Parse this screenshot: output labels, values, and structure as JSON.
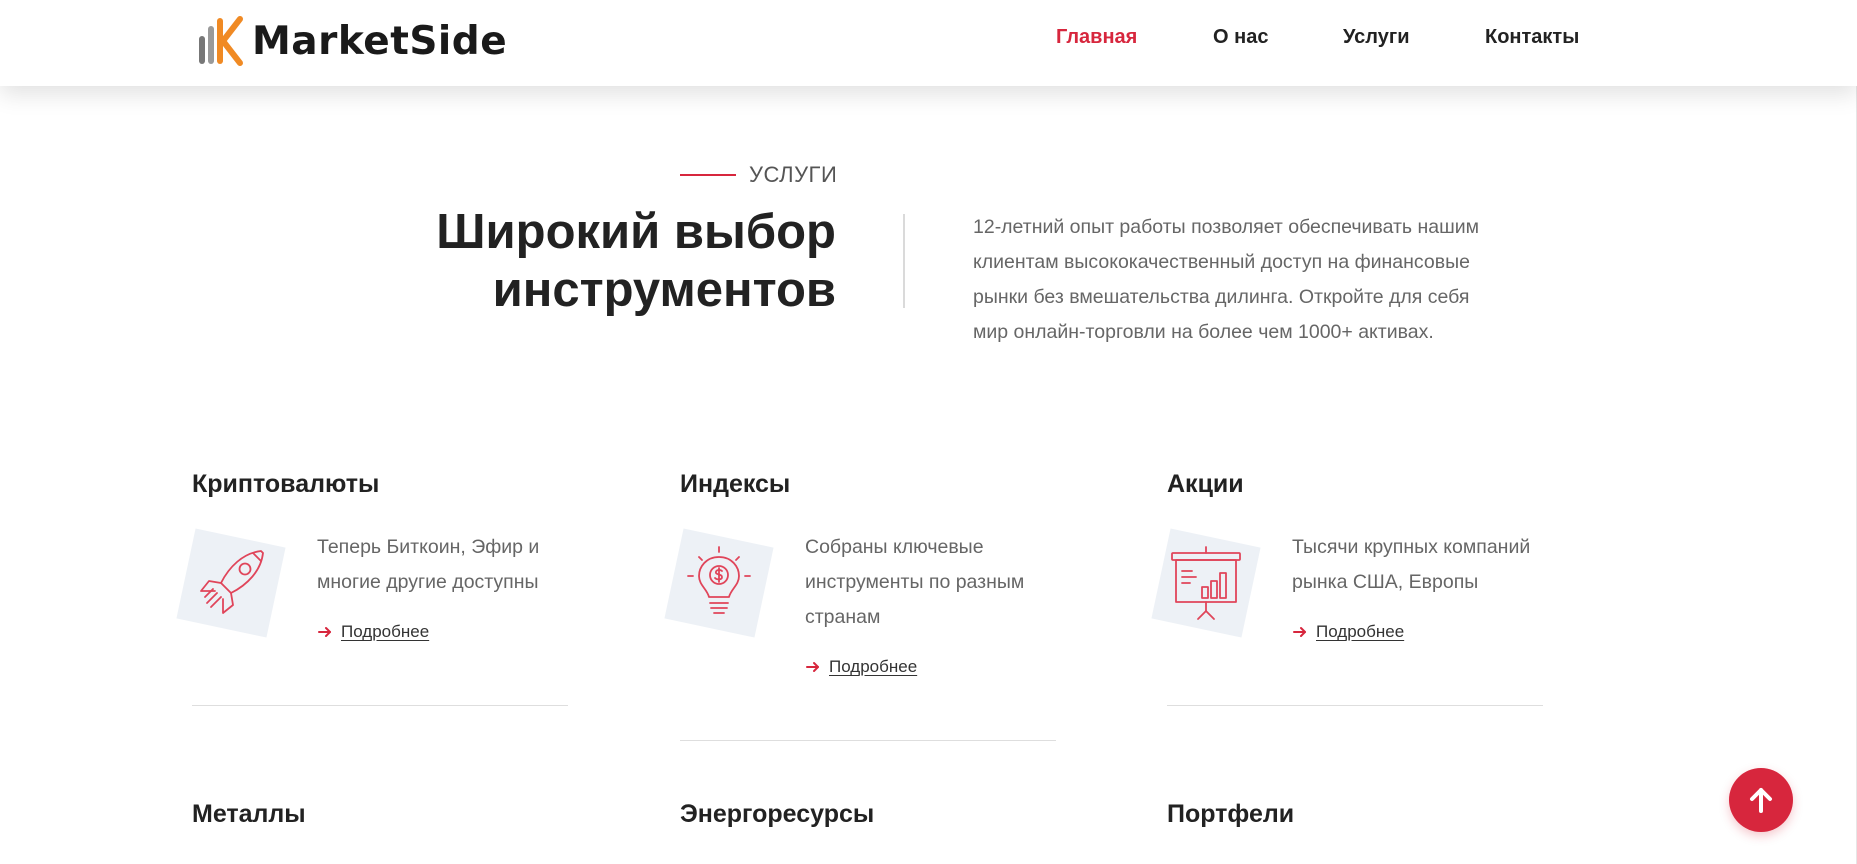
{
  "brand": {
    "name": "MarketSide"
  },
  "nav": {
    "items": [
      {
        "label": "Главная",
        "active": true
      },
      {
        "label": "О нас",
        "active": false
      },
      {
        "label": "Услуги",
        "active": false
      },
      {
        "label": "Контакты",
        "active": false
      }
    ]
  },
  "section": {
    "eyebrow": "УСЛУГИ",
    "title_line1": "Широкий выбор",
    "title_line2": "инструментов",
    "description": "12-летний опыт работы позволяет обеспечивать нашим клиентам высококачественный доступ на финансовые рынки без вмешательства дилинга. Откройте для себя мир онлайн-торговли на более чем 1000+ активах."
  },
  "services": [
    {
      "title": "Криптовалюты",
      "description": "Теперь Биткоин, Эфир и многие другие доступны",
      "link": "Подробнее",
      "icon": "rocket-icon"
    },
    {
      "title": "Индексы",
      "description": "Собраны ключевые инструменты по разным странам",
      "link": "Подробнее",
      "icon": "lightbulb-dollar-icon"
    },
    {
      "title": "Акции",
      "description": "Тысячи крупных компаний рынка США, Европы",
      "link": "Подробнее",
      "icon": "presentation-chart-icon"
    },
    {
      "title": "Металлы"
    },
    {
      "title": "Энергоресурсы"
    },
    {
      "title": "Портфели"
    }
  ],
  "theme": {
    "accent": "#d7263d",
    "icon_bg": "#edf1f6"
  },
  "back_to_top": {
    "icon": "arrow-up-icon"
  }
}
